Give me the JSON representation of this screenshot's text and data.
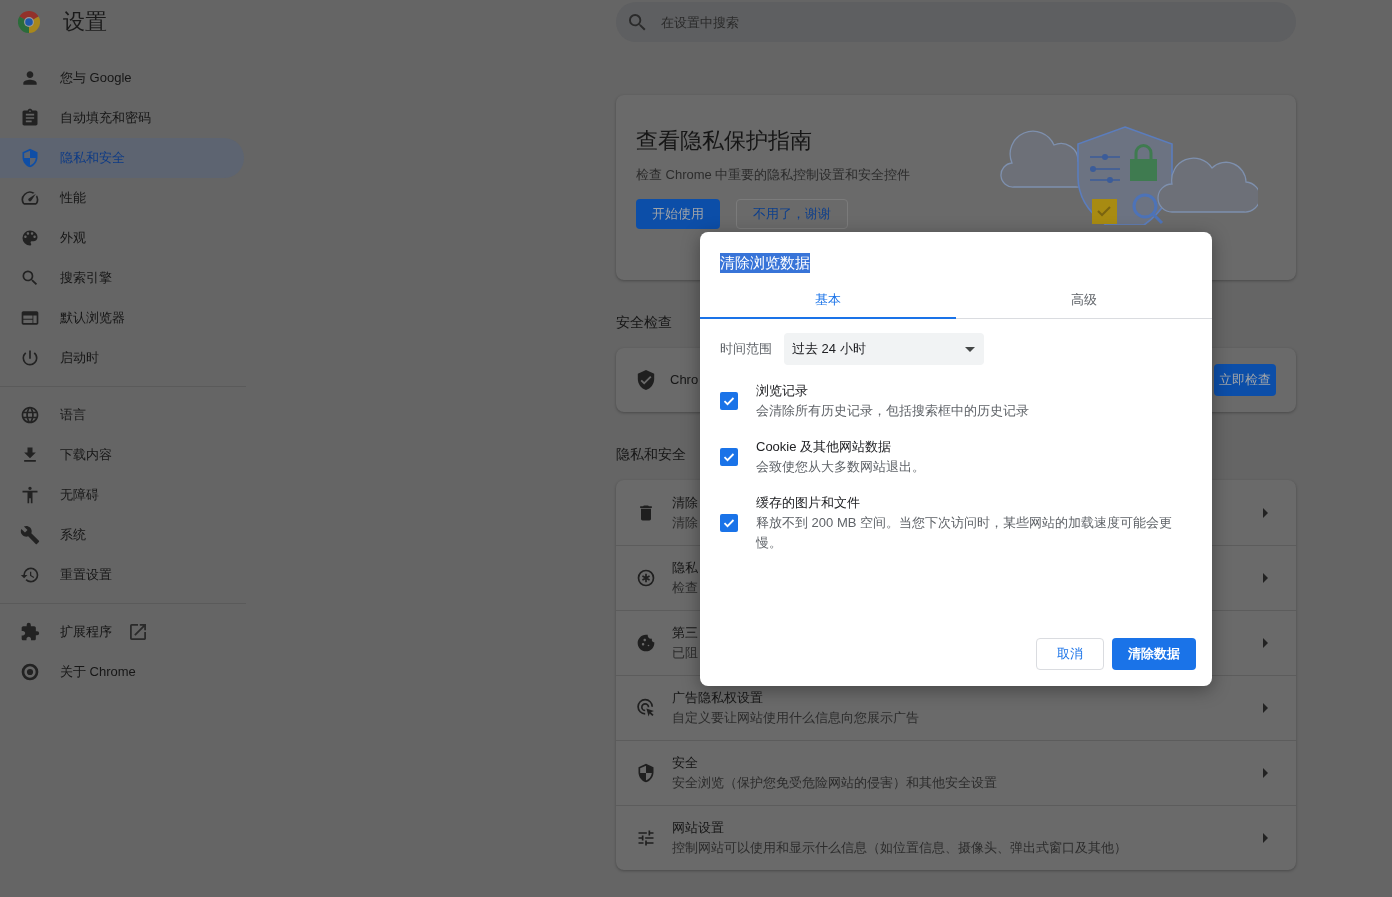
{
  "header": {
    "title": "设置",
    "search": {
      "placeholder": "在设置中搜索"
    }
  },
  "sidebar": {
    "sections": [
      {
        "items": [
          {
            "label": "您与 Google",
            "selected": false,
            "external": false
          },
          {
            "label": "自动填充和密码",
            "selected": false,
            "external": false
          },
          {
            "label": "隐私和安全",
            "selected": true,
            "external": false
          },
          {
            "label": "性能",
            "selected": false,
            "external": false
          },
          {
            "label": "外观",
            "selected": false,
            "external": false
          },
          {
            "label": "搜索引擎",
            "selected": false,
            "external": false
          },
          {
            "label": "默认浏览器",
            "selected": false,
            "external": false
          },
          {
            "label": "启动时",
            "selected": false,
            "external": false
          }
        ]
      },
      {
        "items": [
          {
            "label": "语言",
            "selected": false,
            "external": false
          },
          {
            "label": "下载内容",
            "selected": false,
            "external": false
          },
          {
            "label": "无障碍",
            "selected": false,
            "external": false
          },
          {
            "label": "系统",
            "selected": false,
            "external": false
          },
          {
            "label": "重置设置",
            "selected": false,
            "external": false
          }
        ]
      },
      {
        "items": [
          {
            "label": "扩展程序",
            "selected": false,
            "external": true
          },
          {
            "label": "关于 Chrome",
            "selected": false,
            "external": false
          }
        ]
      }
    ]
  },
  "privacy_guide": {
    "title": "查看隐私保护指南",
    "description": "检查 Chrome 中重要的隐私控制设置和安全控件",
    "buttons": [
      {
        "label": "开始使用",
        "kind": "primary"
      },
      {
        "label": "不用了，谢谢",
        "kind": "secondary"
      }
    ]
  },
  "safety_check": {
    "heading": "安全检查",
    "text": "Chro",
    "button": "立即检查"
  },
  "privacy_security": {
    "heading": "隐私和安全",
    "rows": [
      {
        "title": "清除",
        "description": "清除"
      },
      {
        "title": "隐私",
        "description": "检查"
      },
      {
        "title": "第三",
        "description": "已阻"
      },
      {
        "title": "广告隐私权设置",
        "description": "自定义要让网站使用什么信息向您展示广告"
      },
      {
        "title": "安全",
        "description": "安全浏览（保护您免受危险网站的侵害）和其他安全设置"
      },
      {
        "title": "网站设置",
        "description": "控制网站可以使用和显示什么信息（如位置信息、摄像头、弹出式窗口及其他）"
      }
    ]
  },
  "dialog": {
    "title": {
      "text": "清除浏览数据",
      "highlighted": true
    },
    "tabs": [
      {
        "label": "基本",
        "selected": true
      },
      {
        "label": "高级",
        "selected": false
      }
    ],
    "time_range": {
      "label": "时间范围",
      "value": "过去 24 小时"
    },
    "options": [
      {
        "title": "浏览记录",
        "description": "会清除所有历史记录，包括搜索框中的历史记录",
        "checked": true
      },
      {
        "title": "Cookie 及其他网站数据",
        "description": "会致使您从大多数网站退出。",
        "checked": true
      },
      {
        "title": "缓存的图片和文件",
        "description": "释放不到 200 MB 空间。当您下次访问时，某些网站的加载速度可能会更慢。",
        "checked": true
      }
    ],
    "buttons": [
      {
        "label": "取消",
        "kind": "secondary"
      },
      {
        "label": "清除数据",
        "kind": "primary"
      }
    ]
  }
}
